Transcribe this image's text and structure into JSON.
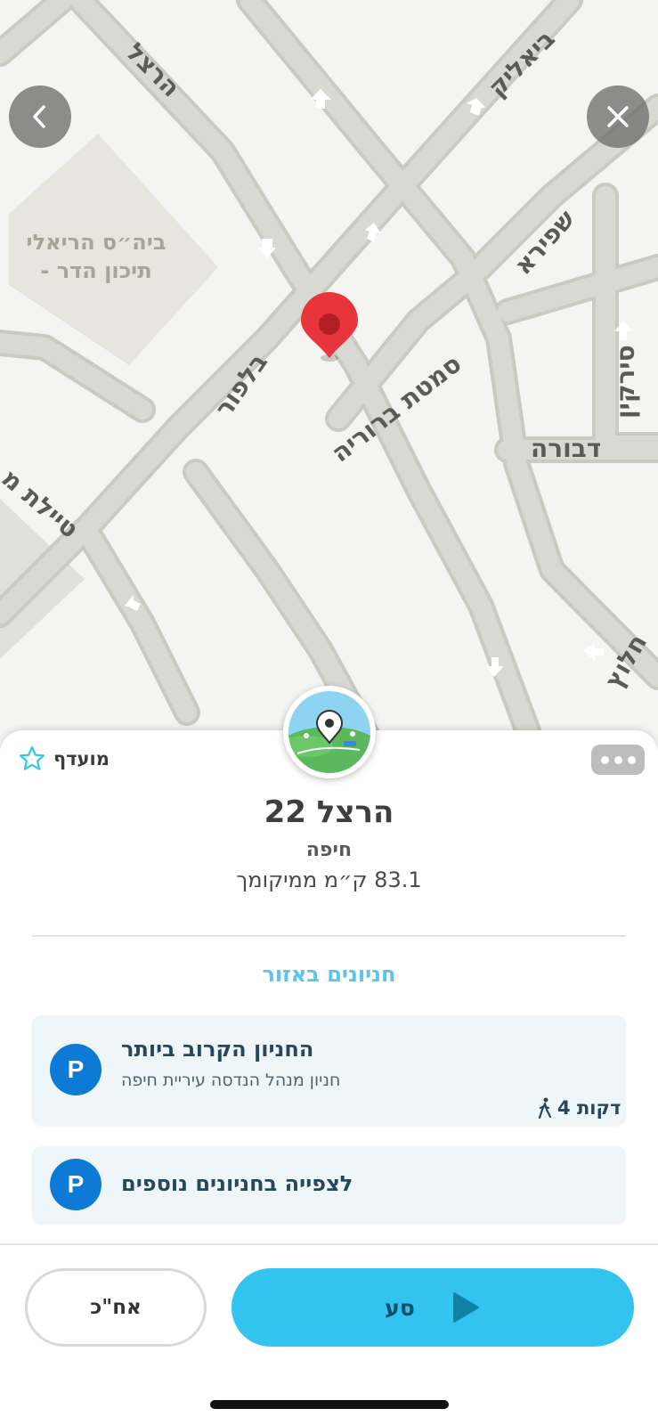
{
  "map": {
    "street_labels": [
      "הרצל",
      "ביאליק",
      "שפירא",
      "בלפור",
      "סמטת ברוריה",
      "סירקין",
      "דבורה",
      "טיילת מ",
      "חלוץ"
    ],
    "poi_label_line1": "ביה״ס הריאלי",
    "poi_label_line2": "- תיכון הדר"
  },
  "header": {
    "back_icon": "chevron-left-icon",
    "close_icon": "close-icon"
  },
  "place": {
    "favorite_label": "מועדף",
    "title": "הרצל 22",
    "city": "חיפה",
    "distance": "83.1 ק״מ ממיקומך"
  },
  "parking": {
    "section_title": "חניונים באזור",
    "badge": "P",
    "nearest": {
      "title": "החניון הקרוב ביותר",
      "subtitle": "חניון מנהל הנדסה עיריית חיפה",
      "walk": "4 דקות"
    },
    "more_label": "לצפייה בחניונים נוספים"
  },
  "actions": {
    "later_label": "אח\"כ",
    "go_label": "סע"
  },
  "colors": {
    "accent": "#33c3ef",
    "parking_badge": "#0d7bd6",
    "pin": "#e8343b"
  }
}
